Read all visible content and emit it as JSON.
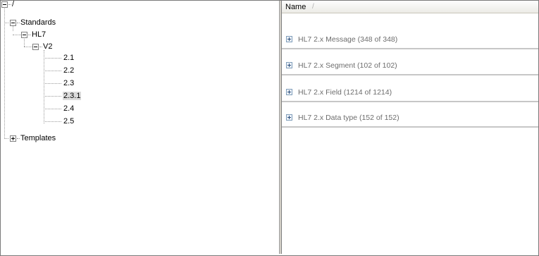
{
  "tree": {
    "root": "/",
    "standards": "Standards",
    "hl7": "HL7",
    "v2": "V2",
    "versions": [
      "2.1",
      "2.2",
      "2.3",
      "2.3.1",
      "2.4",
      "2.5"
    ],
    "selected_version": "2.3.1",
    "templates": "Templates"
  },
  "list": {
    "column_header": "Name",
    "sort_indicator": "/",
    "groups": [
      "HL7 2.x Message (348 of 348)",
      "HL7 2.x Segment (102 of 102)",
      "HL7 2.x Field (1214 of 1214)",
      "HL7 2.x Data type (152 of 152)"
    ]
  },
  "icons": {
    "tree_expanded": "minus-box-icon",
    "tree_collapsed": "plus-box-icon",
    "group_expand": "plus-box-icon"
  }
}
